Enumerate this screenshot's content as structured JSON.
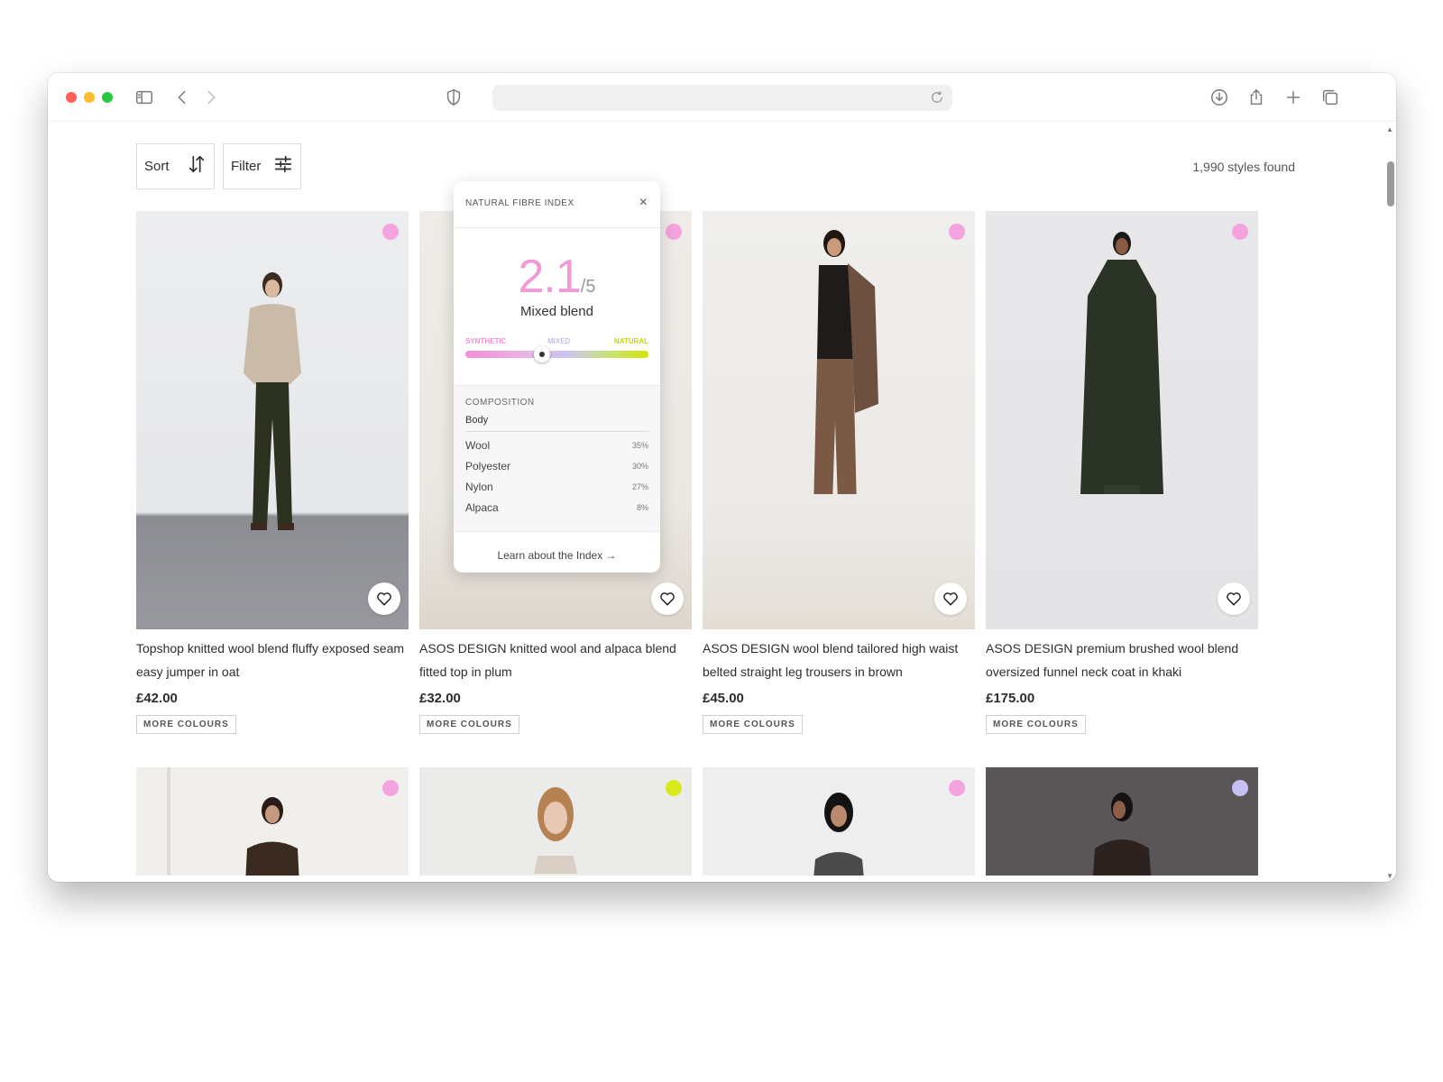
{
  "browser": {
    "icons": [
      "sidebar-icon",
      "back-icon",
      "forward-icon",
      "shield-icon",
      "reload-icon",
      "download-icon",
      "share-icon",
      "new-tab-icon",
      "tabs-icon"
    ]
  },
  "toolbar": {
    "sort_label": "Sort",
    "filter_label": "Filter",
    "styles_found": "1,990 styles found"
  },
  "colors": {
    "pink": "#f4a3df",
    "lime": "#d8ea1a",
    "lavender": "#c7c0f2"
  },
  "products": [
    {
      "name": "Topshop knitted wool blend fluffy exposed seam easy jumper in oat",
      "price": "£42.00",
      "more": "MORE COLOURS",
      "dot": "#f4a3df"
    },
    {
      "name": "ASOS DESIGN knitted wool and alpaca blend fitted top in plum",
      "price": "£32.00",
      "more": "MORE COLOURS",
      "dot": "#f4a3df"
    },
    {
      "name": "ASOS DESIGN wool blend tailored high waist belted straight leg trousers in brown herringbone...",
      "price": "£45.00",
      "more": "MORE COLOURS",
      "dot": "#f4a3df"
    },
    {
      "name": "ASOS DESIGN premium brushed wool blend oversized funnel neck coat in khaki",
      "price": "£175.00",
      "more": "MORE COLOURS",
      "dot": "#f4a3df"
    }
  ],
  "second_row_dots": [
    "#f4a3df",
    "#d8ea1a",
    "#f4a3df",
    "#c7c0f2"
  ],
  "popup": {
    "title": "NATURAL FIBRE INDEX",
    "close": "×",
    "score": "2.1",
    "score_max": "/5",
    "label": "Mixed blend",
    "score_value": 2.1,
    "scale": {
      "synthetic": "SYNTHETIC",
      "mixed": "MIXED",
      "natural": "NATURAL"
    },
    "composition_title": "COMPOSITION",
    "section": "Body",
    "materials": [
      {
        "name": "Wool",
        "pct": "35%"
      },
      {
        "name": "Polyester",
        "pct": "30%"
      },
      {
        "name": "Nylon",
        "pct": "27%"
      },
      {
        "name": "Alpaca",
        "pct": "8%"
      }
    ],
    "learn_link": "Learn about the Index →"
  }
}
